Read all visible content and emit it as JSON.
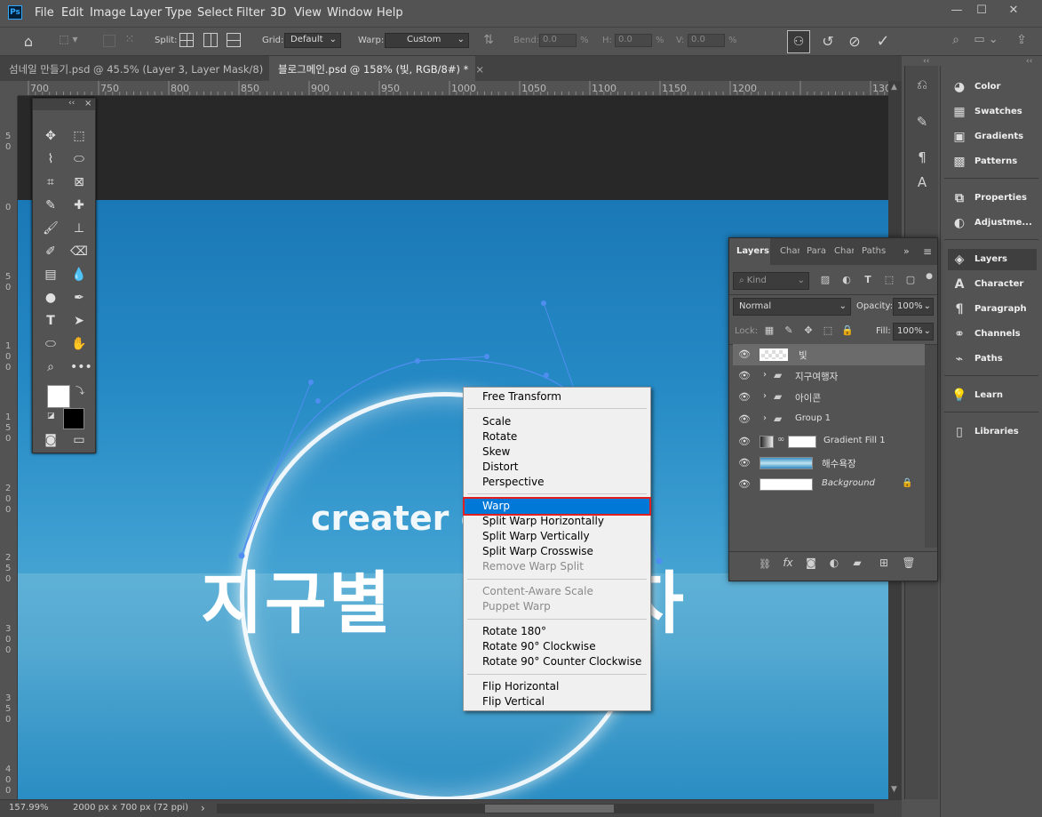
{
  "app": {
    "logo": "Ps"
  },
  "menubar": {
    "items": [
      "File",
      "Edit",
      "Image",
      "Layer",
      "Type",
      "Select",
      "Filter",
      "3D",
      "View",
      "Window",
      "Help"
    ]
  },
  "options": {
    "split_label": "Split:",
    "grid_label": "Grid:",
    "grid_value": "Default",
    "warp_label": "Warp:",
    "warp_value": "Custom",
    "bend_label": "Bend:",
    "bend_value": "0.0",
    "bend_unit": "%",
    "h_label": "H:",
    "h_value": "0.0",
    "h_unit": "%",
    "v_label": "V:",
    "v_value": "0.0",
    "v_unit": "%"
  },
  "tabs": [
    {
      "label": "섬네일 만들기.psd @ 45.5% (Layer 3, Layer Mask/8)",
      "close": "×"
    },
    {
      "label": "블로그메인.psd @ 158% (빛, RGB/8#) *",
      "close": "×"
    }
  ],
  "ruler": {
    "top": [
      "700",
      "750",
      "800",
      "850",
      "900",
      "950",
      "1000",
      "1050",
      "1100",
      "1150",
      "1200",
      "130"
    ],
    "left": [
      "5\n0",
      "0",
      "5\n0",
      "1\n0\n0",
      "1\n5\n0",
      "2\n0\n0",
      "2\n5\n0",
      "3\n0\n0",
      "3\n5\n0",
      "4\n0\n0"
    ]
  },
  "canvas": {
    "text1": "creater o",
    "text2": "지구별",
    "text3": "자",
    "accent": "#2b86c2"
  },
  "status": {
    "zoom": "157.99%",
    "size": "2000 px x 700 px (72 ppi)",
    "arrow": "›"
  },
  "context_menu": {
    "groups": [
      [
        {
          "label": "Free Transform",
          "disabled": false
        }
      ],
      [
        {
          "label": "Scale",
          "disabled": false
        },
        {
          "label": "Rotate",
          "disabled": false
        },
        {
          "label": "Skew",
          "disabled": false
        },
        {
          "label": "Distort",
          "disabled": false
        },
        {
          "label": "Perspective",
          "disabled": false
        }
      ],
      [
        {
          "label": "Warp",
          "disabled": false,
          "highlighted": true
        },
        {
          "label": "Split Warp Horizontally",
          "disabled": false
        },
        {
          "label": "Split Warp Vertically",
          "disabled": false
        },
        {
          "label": "Split Warp Crosswise",
          "disabled": false
        },
        {
          "label": "Remove Warp Split",
          "disabled": true
        }
      ],
      [
        {
          "label": "Content-Aware Scale",
          "disabled": true
        },
        {
          "label": "Puppet Warp",
          "disabled": true
        }
      ],
      [
        {
          "label": "Rotate 180°",
          "disabled": false
        },
        {
          "label": "Rotate 90° Clockwise",
          "disabled": false
        },
        {
          "label": "Rotate 90° Counter Clockwise",
          "disabled": false
        }
      ],
      [
        {
          "label": "Flip Horizontal",
          "disabled": false
        },
        {
          "label": "Flip Vertical",
          "disabled": false
        }
      ]
    ]
  },
  "layers_panel": {
    "tabs": [
      "Layers",
      "Char",
      "Para",
      "Char",
      "Paths"
    ],
    "kind_label": "Kind",
    "blend_mode": "Normal",
    "opacity_label": "Opacity:",
    "opacity_value": "100%",
    "lock_label": "Lock:",
    "fill_label": "Fill:",
    "fill_value": "100%",
    "layers": [
      {
        "name": "빛",
        "type": "pixel",
        "selected": true
      },
      {
        "name": "지구여행자",
        "type": "group"
      },
      {
        "name": "아이콘",
        "type": "group"
      },
      {
        "name": "Group 1",
        "type": "group"
      },
      {
        "name": "Gradient Fill 1",
        "type": "fill"
      },
      {
        "name": "해수욕장",
        "type": "image"
      },
      {
        "name": "Background",
        "type": "background",
        "locked": true
      }
    ]
  },
  "right_dock": {
    "items": [
      "Color",
      "Swatches",
      "Gradients",
      "Patterns",
      "Properties",
      "Adjustme...",
      "Layers",
      "Character",
      "Paragraph",
      "Channels",
      "Paths",
      "Learn",
      "Libraries"
    ]
  }
}
